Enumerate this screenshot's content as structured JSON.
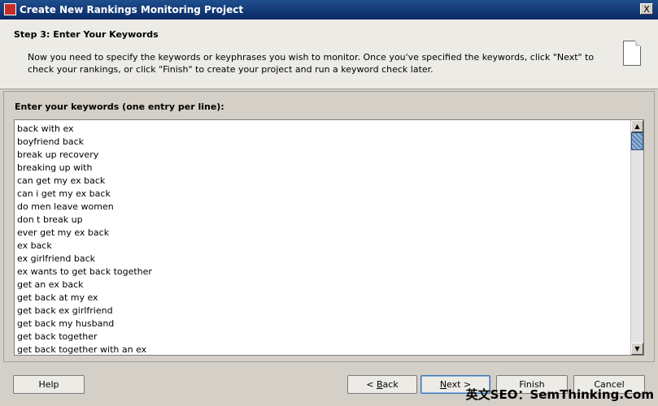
{
  "window": {
    "title": "Create New Rankings Monitoring Project",
    "close_glyph": "X"
  },
  "header": {
    "step_title": "Step 3: Enter Your Keywords",
    "description": "Now you need to specify the keywords or keyphrases you wish to monitor. Once you've specified the keywords, click \"Next\" to check your rankings, or click \"Finish\" to create your project and run a keyword check later."
  },
  "keywords_section": {
    "label": "Enter your keywords (one entry per line):",
    "keywords": [
      "back with ex",
      "boyfriend back",
      "break up recovery",
      "breaking up with",
      "can get my ex back",
      "can i get my ex back",
      "do men leave women",
      "don t break up",
      "ever get my ex back",
      "ex back",
      "ex girlfriend back",
      "ex wants to get back together",
      "get an ex back",
      "get back at my ex",
      "get back ex girlfriend",
      "get back my husband",
      "get back together",
      "get back together with an ex"
    ]
  },
  "buttons": {
    "help": "Help",
    "back_prefix": "< ",
    "back_mnemonic": "B",
    "back_rest": "ack",
    "next_mnemonic": "N",
    "next_rest": "ext >",
    "finish": "Finish",
    "cancel": "Cancel"
  },
  "watermark": "英文SEO：SemThinking.Com"
}
